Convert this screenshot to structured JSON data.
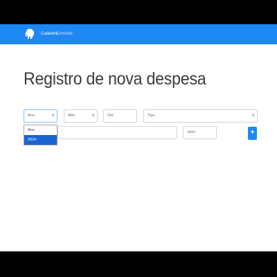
{
  "navbar": {
    "brand_icon": "elephant-logo-icon",
    "links": [
      "Cadastro",
      "Consulta"
    ],
    "color": "#1e88f5"
  },
  "page": {
    "title": "Registro de nova despesa"
  },
  "form": {
    "ano": {
      "value": "Ano",
      "options": [
        "Ano",
        "2024"
      ],
      "selected_option": "2024"
    },
    "mes": {
      "value": "Mês"
    },
    "dia": {
      "placeholder": "Dia"
    },
    "tipo": {
      "value": "Tipo"
    },
    "descricao": {
      "placeholder": ""
    },
    "valor": {
      "placeholder": "Valor"
    },
    "add_button": {
      "label": "+"
    }
  }
}
